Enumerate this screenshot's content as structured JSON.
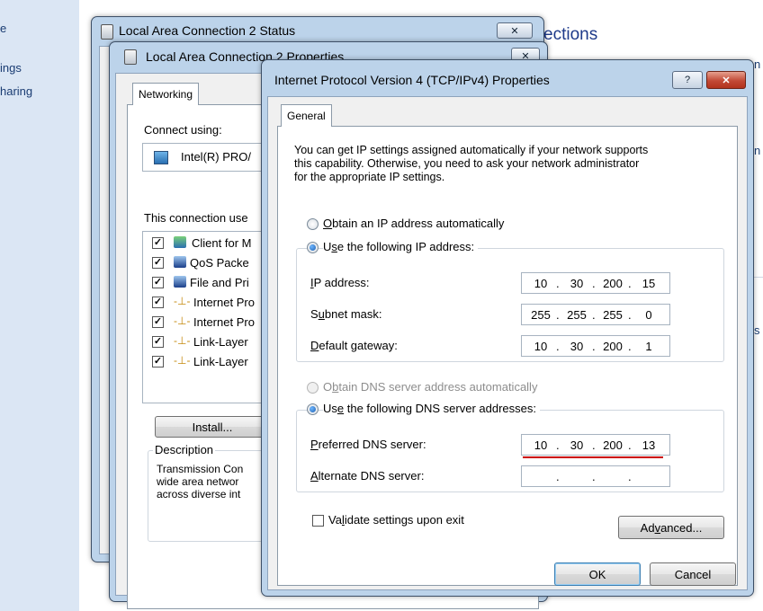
{
  "control_panel": {
    "left_links": [
      "e",
      "ings",
      "haring"
    ],
    "title": "ections",
    "right_edge": [
      "n",
      "n",
      "s"
    ]
  },
  "status_window": {
    "title": "Local Area Connection 2 Status"
  },
  "props_window": {
    "title": "Local Area Connection 2 Properties",
    "tab": "Networking",
    "connect_using_label": "Connect using:",
    "adapter": "Intel(R) PRO/",
    "items_label": "This connection use",
    "items": [
      {
        "label": "Client for M",
        "checked": true,
        "icon": "network-client-icon"
      },
      {
        "label": "QoS Packe",
        "checked": true,
        "icon": "qos-icon"
      },
      {
        "label": "File and Pri",
        "checked": true,
        "icon": "file-sharing-icon"
      },
      {
        "label": "Internet Pro",
        "checked": true,
        "icon": "protocol-icon"
      },
      {
        "label": "Internet Pro",
        "checked": true,
        "icon": "protocol-icon"
      },
      {
        "label": "Link-Layer",
        "checked": true,
        "icon": "protocol-icon"
      },
      {
        "label": "Link-Layer",
        "checked": true,
        "icon": "protocol-icon"
      }
    ],
    "install_button": "Install...",
    "description_label": "Description",
    "description_lines": [
      "Transmission Con",
      "wide area networ",
      "across diverse int"
    ]
  },
  "ipv4_dialog": {
    "title": "Internet Protocol Version 4 (TCP/IPv4) Properties",
    "help_glyph": "?",
    "close_glyph": "✕",
    "tab": "General",
    "intro_lines": [
      "You can get IP settings assigned automatically if your network supports",
      "this capability. Otherwise, you need to ask your network administrator",
      "for the appropriate IP settings."
    ],
    "ip_auto": {
      "label_pre": "",
      "label_key": "O",
      "label_post": "btain an IP address automatically",
      "selected": false
    },
    "ip_manual": {
      "label_pre": "U",
      "label_key": "s",
      "label_post": "e the following IP address:",
      "selected": true
    },
    "fields": {
      "ip": {
        "label_pre": "",
        "label_key": "I",
        "label_post": "P address:",
        "octets": [
          "10",
          "30",
          "200",
          "15"
        ]
      },
      "mask": {
        "label_pre": "S",
        "label_key": "u",
        "label_post": "bnet mask:",
        "octets": [
          "255",
          "255",
          "255",
          "0"
        ]
      },
      "gateway": {
        "label_pre": "",
        "label_key": "D",
        "label_post": "efault gateway:",
        "octets": [
          "10",
          "30",
          "200",
          "1"
        ]
      },
      "dns_pref": {
        "label_pre": "",
        "label_key": "P",
        "label_post": "referred DNS server:",
        "octets": [
          "10",
          "30",
          "200",
          "13"
        ]
      },
      "dns_alt": {
        "label_pre": "",
        "label_key": "A",
        "label_post": "lternate DNS server:",
        "octets": [
          "",
          "",
          "",
          ""
        ]
      }
    },
    "dns_auto": {
      "label_pre": "O",
      "label_key": "b",
      "label_post": "tain DNS server address automatically",
      "selected": false,
      "disabled": true
    },
    "dns_manual": {
      "label_pre": "Us",
      "label_key": "e",
      "label_post": " the following DNS server addresses:",
      "selected": true
    },
    "validate": {
      "label_pre": "Va",
      "label_key": "l",
      "label_post": "idate settings upon exit",
      "checked": false
    },
    "advanced_button": {
      "pre": "Ad",
      "key": "v",
      "post": "anced..."
    },
    "ok_button": "OK",
    "cancel_button": "Cancel",
    "highlight_color": "#cc0000"
  }
}
